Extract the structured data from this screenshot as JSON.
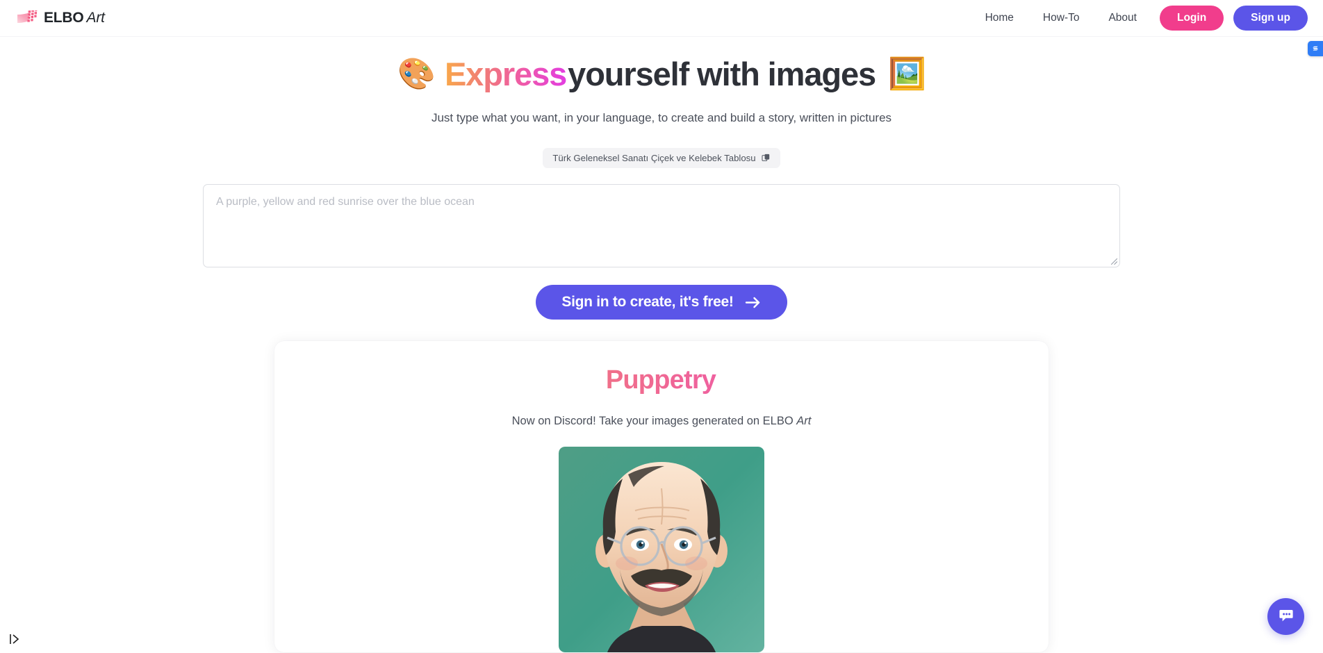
{
  "header": {
    "brand": {
      "name_bold": "ELBO",
      "name_italic": "Art",
      "logo_icon": "elbo-flag-logo"
    },
    "nav": [
      {
        "label": "Home",
        "name": "nav-link-home"
      },
      {
        "label": "How-To",
        "name": "nav-link-how-to"
      },
      {
        "label": "About",
        "name": "nav-link-about"
      }
    ],
    "login_label": "Login",
    "signup_label": "Sign up",
    "login_color": "#f13d8c",
    "signup_color": "#5b55e8",
    "extension_badge_icon": "browser-extension-icon"
  },
  "hero": {
    "emoji_left": "🎨",
    "title_gradient_word": "Express",
    "title_rest": " yourself with images",
    "emoji_right": "🖼️",
    "subtitle": "Just type what you want, in your language, to create and build a story, written in pictures",
    "gradient_start": "#f9a84a",
    "gradient_end": "#e23ce2"
  },
  "suggestion": {
    "text": "Türk Geleneksel Sanatı Çiçek ve Kelebek Tablosu",
    "copy_icon": "copy-icon"
  },
  "prompt": {
    "value": "",
    "placeholder": "A purple, yellow and red sunrise over the blue ocean",
    "resize_handle_icon": "resize-grip-icon"
  },
  "cta": {
    "label": "Sign in to create, it's free!",
    "arrow_icon": "arrow-right-icon",
    "color": "#5b55e8"
  },
  "card": {
    "title": "Puppetry",
    "subtitle_prefix": "Now on Discord! Take your images generated on ELBO ",
    "subtitle_italic": "Art",
    "image_alt": "caricature-portrait-bald-man-with-glasses-teal-background"
  },
  "chat_fab": {
    "icon": "chat-bubble-icon",
    "color": "#5b55e8"
  },
  "cursor": {
    "icon": "text-cursor-icon"
  }
}
